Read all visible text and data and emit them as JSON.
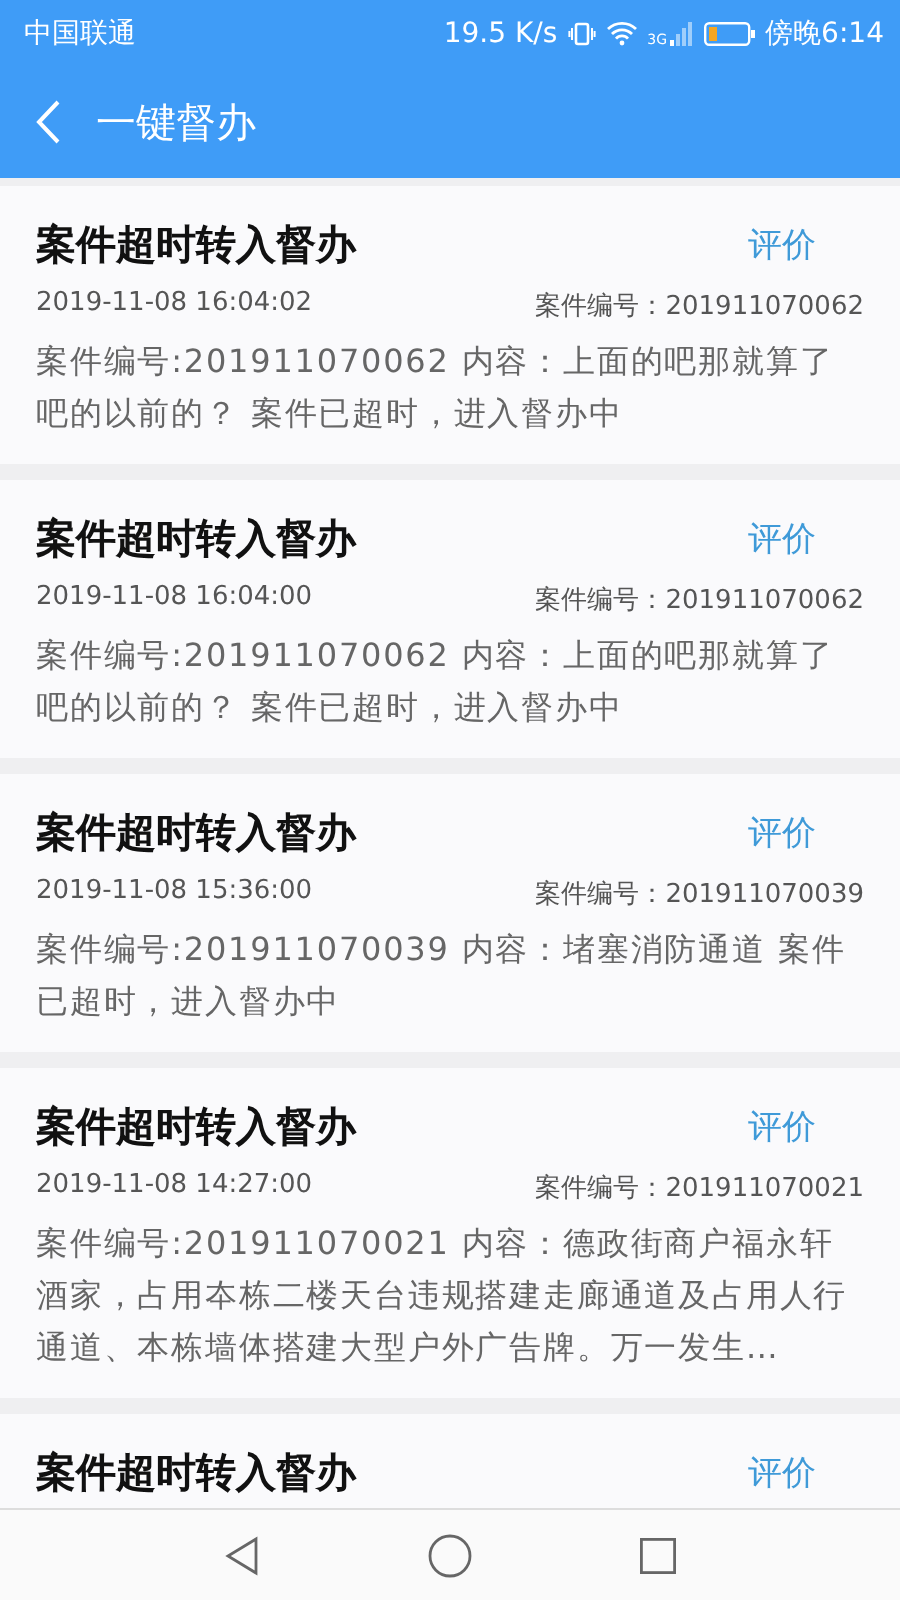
{
  "status_bar": {
    "carrier": "中国联通",
    "speed": "19.5 K/s",
    "network": "3G",
    "time": "傍晚6:14"
  },
  "header": {
    "title": "一键督办"
  },
  "cards": [
    {
      "title": "案件超时转入督办",
      "action": "评价",
      "date": "2019-11-08 16:04:02",
      "case_id": "案件编号：201911070062",
      "content": "案件编号:201911070062 内容：上面的吧那就算了吧的以前的？ 案件已超时，进入督办中"
    },
    {
      "title": "案件超时转入督办",
      "action": "评价",
      "date": "2019-11-08 16:04:00",
      "case_id": "案件编号：201911070062",
      "content": "案件编号:201911070062 内容：上面的吧那就算了吧的以前的？ 案件已超时，进入督办中"
    },
    {
      "title": "案件超时转入督办",
      "action": "评价",
      "date": "2019-11-08 15:36:00",
      "case_id": "案件编号：201911070039",
      "content": "案件编号:201911070039 内容：堵塞消防通道 案件已超时，进入督办中"
    },
    {
      "title": "案件超时转入督办",
      "action": "评价",
      "date": "2019-11-08 14:27:00",
      "case_id": "案件编号：201911070021",
      "content": "案件编号:201911070021 内容：德政街商户福永轩酒家，占用夲栋二楼天台违规搭建走廊通道及占用人行通道、本栋墙体搭建大型户外广告牌。万一发生…"
    },
    {
      "title": "案件超时转入督办",
      "action": "评价"
    }
  ]
}
